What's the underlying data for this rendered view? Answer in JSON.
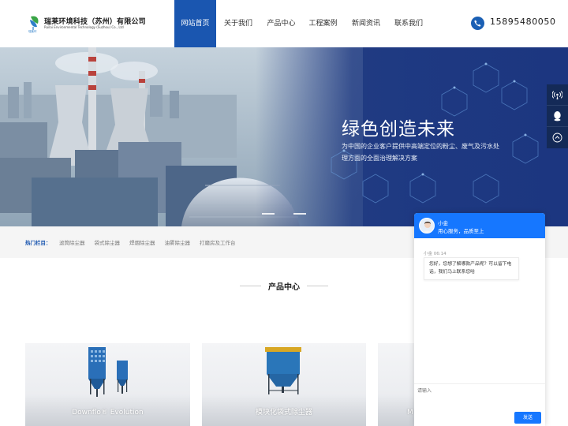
{
  "header": {
    "company_cn": "瑞莱环境科技（苏州）有限公司",
    "company_en": "Ruilai Environmental Technology (Suzhou) Co., Ltd",
    "logo_small": "瑞莱环",
    "nav": [
      {
        "label": "网站首页",
        "active": true
      },
      {
        "label": "关于我们",
        "active": false
      },
      {
        "label": "产品中心",
        "active": false
      },
      {
        "label": "工程案例",
        "active": false
      },
      {
        "label": "新闻资讯",
        "active": false
      },
      {
        "label": "联系我们",
        "active": false
      }
    ],
    "phone": "15895480050"
  },
  "banner": {
    "title": "绿色创造未来",
    "subtitle": "为中国的企业客户提供中高端定位的粉尘、废气及污水处理方面的全面治理解决方案"
  },
  "hot": {
    "label": "热门栏目：",
    "items": [
      "滤筒除尘器",
      "袋式除尘器",
      "焊烟除尘器",
      "油雾除尘器",
      "打磨房及工作台"
    ]
  },
  "products": {
    "title": "产品中心",
    "cards": [
      {
        "caption": "Downflo® Evolution"
      },
      {
        "caption": "模块化袋式除尘器"
      },
      {
        "caption": "M"
      }
    ]
  },
  "chat": {
    "agent_name": "小金",
    "slogan": "用心服务，品质至上",
    "time": "小金 06:14",
    "message": "您好，您想了解哪款产品呢？可以留下电话，我们马上联系您哈",
    "input_placeholder": "请输入",
    "send_label": "发送"
  },
  "colors": {
    "brand_blue": "#1a56b0",
    "chat_blue": "#1677ff",
    "side_bar": "#142a57"
  }
}
